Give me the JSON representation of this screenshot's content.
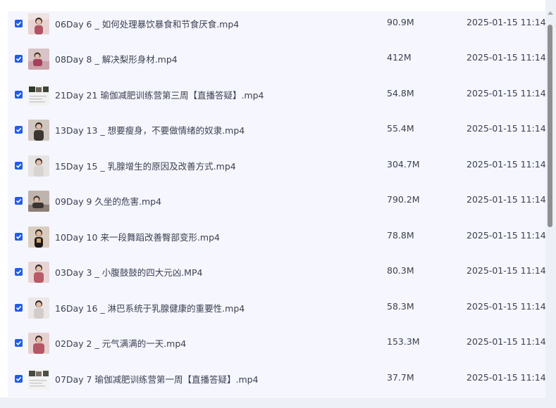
{
  "files": [
    {
      "name": "06Day 6 _ 如何处理暴饮暴食和节食厌食.mp4",
      "size": "90.9M",
      "date": "2025-01-15 11:14",
      "checked": true,
      "thumb": "person-video-thumbnail"
    },
    {
      "name": "08Day 8 _ 解决梨形身材.mp4",
      "size": "412M",
      "date": "2025-01-15 11:14",
      "checked": true,
      "thumb": "person-video-thumbnail"
    },
    {
      "name": "21Day 21 瑜伽减肥训练营第三周【直播答疑】.mp4",
      "size": "54.8M",
      "date": "2025-01-15 11:14",
      "checked": true,
      "thumb": "livestream-video-thumbnail"
    },
    {
      "name": "13Day 13 _ 想要瘦身，不要做情绪的奴隶.mp4",
      "size": "55.4M",
      "date": "2025-01-15 11:14",
      "checked": true,
      "thumb": "person-video-thumbnail"
    },
    {
      "name": "15Day 15 _ 乳腺增生的原因及改善方式.mp4",
      "size": "304.7M",
      "date": "2025-01-15 11:14",
      "checked": true,
      "thumb": "person-video-thumbnail"
    },
    {
      "name": "09Day 9 久坐的危害.mp4",
      "size": "790.2M",
      "date": "2025-01-15 11:14",
      "checked": true,
      "thumb": "person-video-thumbnail"
    },
    {
      "name": "10Day 10 来一段舞蹈改善臀部变形.mp4",
      "size": "78.8M",
      "date": "2025-01-15 11:14",
      "checked": true,
      "thumb": "person-video-thumbnail"
    },
    {
      "name": "03Day 3 _ 小腹鼓鼓的四大元凶.MP4",
      "size": "80.3M",
      "date": "2025-01-15 11:14",
      "checked": true,
      "thumb": "person-video-thumbnail"
    },
    {
      "name": "16Day 16 _ 淋巴系统于乳腺健康的重要性.mp4",
      "size": "58.3M",
      "date": "2025-01-15 11:14",
      "checked": true,
      "thumb": "person-video-thumbnail"
    },
    {
      "name": "02Day 2 _ 元气满满的一天.mp4",
      "size": "153.3M",
      "date": "2025-01-15 11:14",
      "checked": true,
      "thumb": "person-video-thumbnail"
    },
    {
      "name": "07Day 7 瑜伽减肥训练营第一周【直播答疑】.mp4",
      "size": "37.7M",
      "date": "2025-01-15 11:14",
      "checked": true,
      "thumb": "livestream-video-thumbnail"
    }
  ],
  "colors": {
    "checkbox": "#1f5cf0",
    "list_bg": "#f5f6fe",
    "text": "#3c4150"
  }
}
